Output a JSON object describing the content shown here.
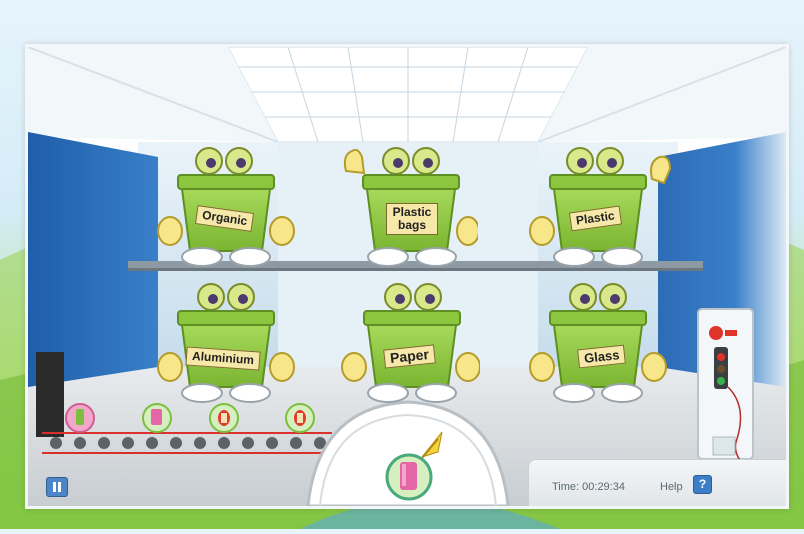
{
  "bins": [
    {
      "label": "Organic",
      "row": "top",
      "waving": false
    },
    {
      "label": "Plastic bags",
      "row": "top",
      "waving": true
    },
    {
      "label": "Plastic",
      "row": "top",
      "waving": true
    },
    {
      "label": "Aluminium",
      "row": "bottom",
      "waving": false
    },
    {
      "label": "Paper",
      "row": "bottom",
      "waving": false
    },
    {
      "label": "Glass",
      "row": "bottom",
      "waving": false
    }
  ],
  "status": {
    "time_text": "Time: 00:29:34",
    "help_label": "Help",
    "help_icon": "?"
  },
  "conveyor": {
    "items": [
      "bottle-item-icon",
      "can-item-icon",
      "apple-core-item-icon",
      "apple-core-item-icon"
    ]
  },
  "current_item": "pink-can-icon",
  "colors": {
    "bin_green": "#8cc63f",
    "wall_blue": "#2f6fb8",
    "label_yellow": "#f6e8a8",
    "belt_red": "#d9312b"
  }
}
